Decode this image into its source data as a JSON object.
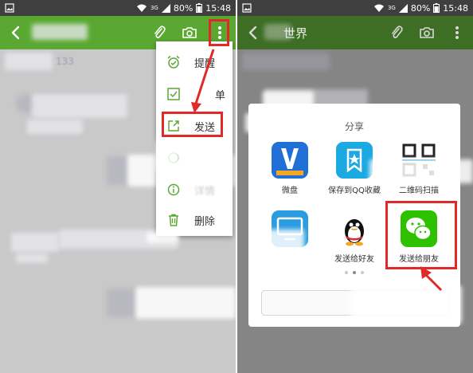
{
  "status_bar": {
    "battery": "80%",
    "time": "15:48",
    "network": "3G"
  },
  "left_screen": {
    "faint_number": "133",
    "menu": {
      "items": [
        {
          "label": "提醒",
          "icon": "alarm-clock-icon"
        },
        {
          "label": "清单",
          "icon": "checkbox-icon"
        },
        {
          "label": "发送",
          "icon": "share-arrow-icon",
          "highlighted": true
        },
        {
          "label": "",
          "icon": "tag-icon"
        },
        {
          "label": "详情",
          "icon": "info-icon"
        },
        {
          "label": "删除",
          "icon": "trash-icon"
        }
      ],
      "partial_labels": {
        "reminder": "提醒",
        "checklist": "单",
        "send": "发送",
        "details": "详情",
        "delete": "删除"
      }
    }
  },
  "right_screen": {
    "title_partial": "世界",
    "share_sheet": {
      "title": "分享",
      "items": [
        {
          "label": "微盘",
          "icon": "weipan-icon"
        },
        {
          "label": "保存到QQ收藏",
          "icon": "qq-favorites-icon"
        },
        {
          "label": "二维码扫描",
          "icon": "qr-code-icon"
        },
        {
          "label": "",
          "icon": "computer-icon"
        },
        {
          "label": "发送给好友",
          "icon": "qq-penguin-icon"
        },
        {
          "label": "发送给朋友",
          "icon": "wechat-icon",
          "highlighted": true
        }
      ],
      "page_indicator": {
        "pages": 3,
        "current": 1
      }
    }
  },
  "colors": {
    "appbar_green": "#5aa832",
    "appbar_green_dim": "#3e6d24",
    "highlight_red": "#e02a2a",
    "wechat_green": "#2dc100",
    "weipan_blue": "#1f6fd6"
  }
}
